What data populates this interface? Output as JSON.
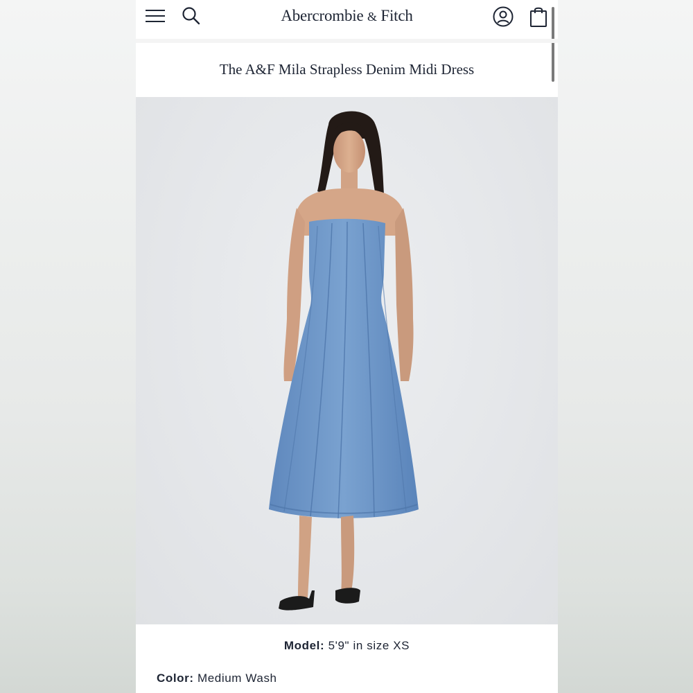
{
  "header": {
    "brand_main": "Abercrombie",
    "brand_amp": "&",
    "brand_end": "Fitch"
  },
  "product": {
    "title": "The A&F Mila Strapless Denim Midi Dress",
    "model_label": "Model:",
    "model_value": "5'9\" in size XS",
    "color_label": "Color:",
    "color_value": "Medium Wash"
  },
  "icons": {
    "menu": "hamburger-menu-icon",
    "search": "search-icon",
    "account": "account-icon",
    "bag": "shopping-bag-icon"
  },
  "colors": {
    "text": "#1d2433",
    "denim": "#6f97c7",
    "background": "#e5e7ea"
  }
}
